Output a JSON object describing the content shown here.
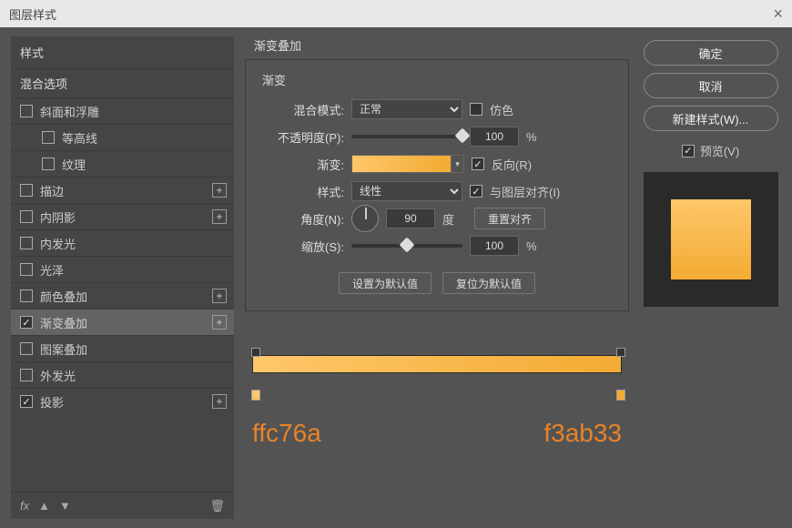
{
  "window": {
    "title": "图层样式"
  },
  "left": {
    "header": "样式",
    "blend_opts": "混合选项",
    "items": [
      {
        "label": "斜面和浮雕",
        "checked": false,
        "indent": false,
        "plus": false
      },
      {
        "label": "等高线",
        "checked": false,
        "indent": true,
        "plus": false
      },
      {
        "label": "纹理",
        "checked": false,
        "indent": true,
        "plus": false
      },
      {
        "label": "描边",
        "checked": false,
        "indent": false,
        "plus": true
      },
      {
        "label": "内阴影",
        "checked": false,
        "indent": false,
        "plus": true
      },
      {
        "label": "内发光",
        "checked": false,
        "indent": false,
        "plus": false
      },
      {
        "label": "光泽",
        "checked": false,
        "indent": false,
        "plus": false
      },
      {
        "label": "颜色叠加",
        "checked": false,
        "indent": false,
        "plus": true
      },
      {
        "label": "渐变叠加",
        "checked": true,
        "indent": false,
        "plus": true,
        "selected": true
      },
      {
        "label": "图案叠加",
        "checked": false,
        "indent": false,
        "plus": false
      },
      {
        "label": "外发光",
        "checked": false,
        "indent": false,
        "plus": false
      },
      {
        "label": "投影",
        "checked": true,
        "indent": false,
        "plus": true
      }
    ],
    "fx": "fx"
  },
  "center": {
    "title": "渐变叠加",
    "subtitle": "渐变",
    "blend_mode_label": "混合模式:",
    "blend_mode_value": "正常",
    "dither_label": "仿色",
    "opacity_label": "不透明度(P):",
    "opacity_value": "100",
    "percent": "%",
    "gradient_label": "渐变:",
    "reverse_label": "反向(R)",
    "style_label": "样式:",
    "style_value": "线性",
    "align_label": "与图层对齐(I)",
    "angle_label": "角度(N):",
    "angle_value": "90",
    "degree": "度",
    "reset_align": "重置对齐",
    "scale_label": "缩放(S):",
    "scale_value": "100",
    "set_default": "设置为默认值",
    "reset_default": "复位为默认值",
    "color1": "ffc76a",
    "color2": "f3ab33",
    "grad_c1": "#ffc76a",
    "grad_c2": "#f3ab33",
    "annot_color": "#e8832a"
  },
  "right": {
    "ok": "确定",
    "cancel": "取消",
    "new_style": "新建样式(W)...",
    "preview": "预览(V)"
  }
}
